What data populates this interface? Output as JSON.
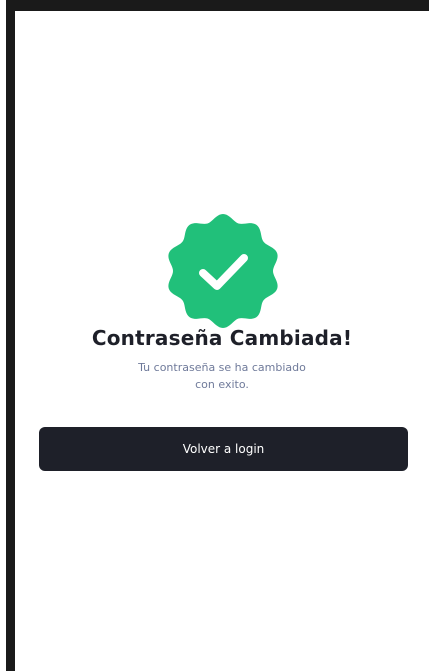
{
  "success": {
    "title": "Contraseña Cambiada!",
    "message_line1": "Tu contraseña se ha cambiado",
    "message_line2": "con exito.",
    "icon": "verified-check-badge-icon"
  },
  "actions": {
    "back_label": "Volver a login"
  },
  "colors": {
    "accent_green": "#21c07a",
    "button_dark": "#1e2029",
    "subtitle_gray": "#6f7a9a"
  }
}
